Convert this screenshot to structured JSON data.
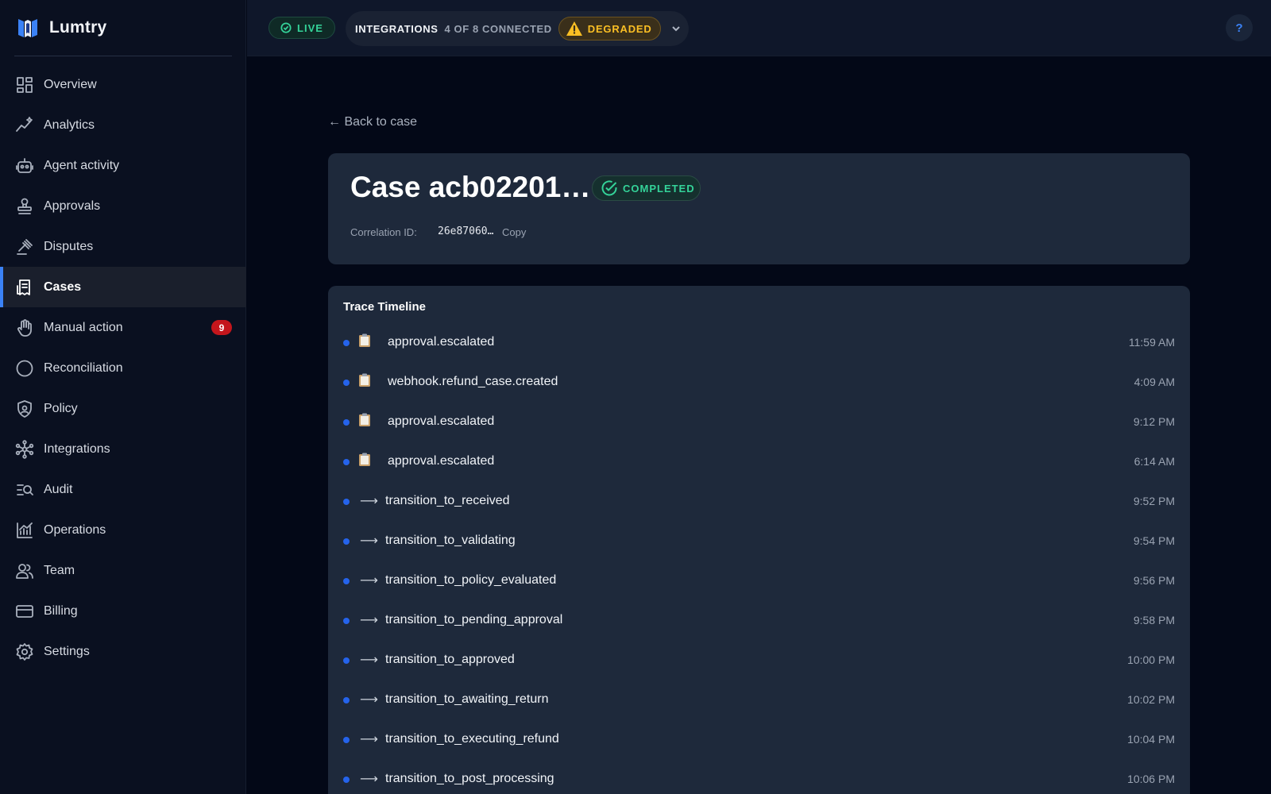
{
  "brand": {
    "name": "Lumtry"
  },
  "sidebar": {
    "items": [
      {
        "label": "Overview",
        "icon": "grid-icon"
      },
      {
        "label": "Analytics",
        "icon": "sparkline-icon"
      },
      {
        "label": "Agent activity",
        "icon": "robot-icon"
      },
      {
        "label": "Approvals",
        "icon": "stamp-icon"
      },
      {
        "label": "Disputes",
        "icon": "gavel-icon"
      },
      {
        "label": "Cases",
        "icon": "receipt-icon",
        "active": true
      },
      {
        "label": "Manual action",
        "icon": "hand-icon",
        "badge": "9"
      },
      {
        "label": "Reconciliation",
        "icon": "circle-icon"
      },
      {
        "label": "Policy",
        "icon": "shield-icon"
      },
      {
        "label": "Integrations",
        "icon": "network-icon"
      },
      {
        "label": "Audit",
        "icon": "search-list-icon"
      },
      {
        "label": "Operations",
        "icon": "chart-icon"
      },
      {
        "label": "Team",
        "icon": "users-icon"
      },
      {
        "label": "Billing",
        "icon": "card-icon"
      },
      {
        "label": "Settings",
        "icon": "gear-icon"
      }
    ]
  },
  "topbar": {
    "live_label": "LIVE",
    "integrations_label": "INTEGRATIONS",
    "integrations_count": "4 OF 8 CONNECTED",
    "status_label": "DEGRADED",
    "help_label": "?"
  },
  "main": {
    "back_label": "← Back to case",
    "case_title": "Case acb02201…",
    "status_label": "COMPLETED",
    "correlation_label": "Correlation ID:",
    "correlation_value": "26e87060…",
    "copy_label": "Copy",
    "timeline_title": "Trace Timeline",
    "timeline": [
      {
        "icon": "clipboard-icon",
        "name": "approval.escalated",
        "time": "11:59 AM"
      },
      {
        "icon": "clipboard-icon",
        "name": "webhook.refund_case.created",
        "time": "4:09 AM"
      },
      {
        "icon": "clipboard-icon",
        "name": "approval.escalated",
        "time": "9:12 PM"
      },
      {
        "icon": "clipboard-icon",
        "name": "approval.escalated",
        "time": "6:14 AM"
      },
      {
        "icon": "arrow-right-icon",
        "name": "transition_to_received",
        "time": "9:52 PM"
      },
      {
        "icon": "arrow-right-icon",
        "name": "transition_to_validating",
        "time": "9:54 PM"
      },
      {
        "icon": "arrow-right-icon",
        "name": "transition_to_policy_evaluated",
        "time": "9:56 PM"
      },
      {
        "icon": "arrow-right-icon",
        "name": "transition_to_pending_approval",
        "time": "9:58 PM"
      },
      {
        "icon": "arrow-right-icon",
        "name": "transition_to_approved",
        "time": "10:00 PM"
      },
      {
        "icon": "arrow-right-icon",
        "name": "transition_to_awaiting_return",
        "time": "10:02 PM"
      },
      {
        "icon": "arrow-right-icon",
        "name": "transition_to_executing_refund",
        "time": "10:04 PM"
      },
      {
        "icon": "arrow-right-icon",
        "name": "transition_to_post_processing",
        "time": "10:06 PM"
      }
    ]
  },
  "colors": {
    "accent": "#3b82f6",
    "success": "#34d399",
    "warning": "#fbbf24",
    "danger": "#c4161c"
  }
}
